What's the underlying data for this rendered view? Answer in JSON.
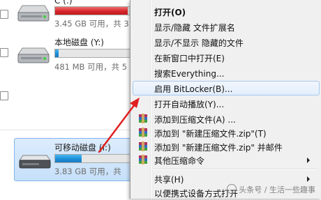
{
  "drives": [
    {
      "name": "C (:)",
      "info": "3.45 GB 可用，共 3",
      "usage_fraction": 0.96,
      "bar_color": "#d6262a",
      "selected": false
    },
    {
      "name": "本地磁盘 (Y:)",
      "info": "481 MB 可用，共 5",
      "usage_fraction": 0.05,
      "bar_color": "#1c8fd8",
      "selected": false
    },
    {
      "name": "可移动磁盘 (I:)",
      "info": "3.83 GB 可用，共",
      "usage_fraction": 0.35,
      "bar_color": "#1c8fd8",
      "selected": true
    }
  ],
  "context_menu": {
    "items": [
      {
        "label": "打开(O)",
        "bold": true
      },
      {
        "label": "显示/隐藏 文件扩展名"
      },
      {
        "label": "显示/不显示 隐藏的文件"
      },
      {
        "label": "在新窗口中打开(E)"
      },
      {
        "label": "搜索Everything..."
      },
      {
        "label": "启用 BitLocker(B)...",
        "highlighted": true
      },
      {
        "label": "打开自动播放(Y)..."
      },
      {
        "label": "添加到压缩文件(A) ...",
        "icon": "archive-icon"
      },
      {
        "label": "添加到 \"新建压缩文件.zip\"(T)",
        "icon": "archive-icon"
      },
      {
        "label": "添加到 \"新建压缩文件.zip\" 并邮件",
        "icon": "archive-icon"
      },
      {
        "label": "其他压缩命令",
        "icon": "archive-icon",
        "submenu": true
      },
      {
        "label": "共享(H)",
        "submenu": true
      },
      {
        "label": "以便携式设备方式打开"
      }
    ]
  },
  "watermark": {
    "text": "头条号 / 生活一些趣事"
  },
  "colors": {
    "annotation_arrow": "#e02020",
    "selection": "#cde4fb",
    "menu_background": "#f0f0f0"
  }
}
